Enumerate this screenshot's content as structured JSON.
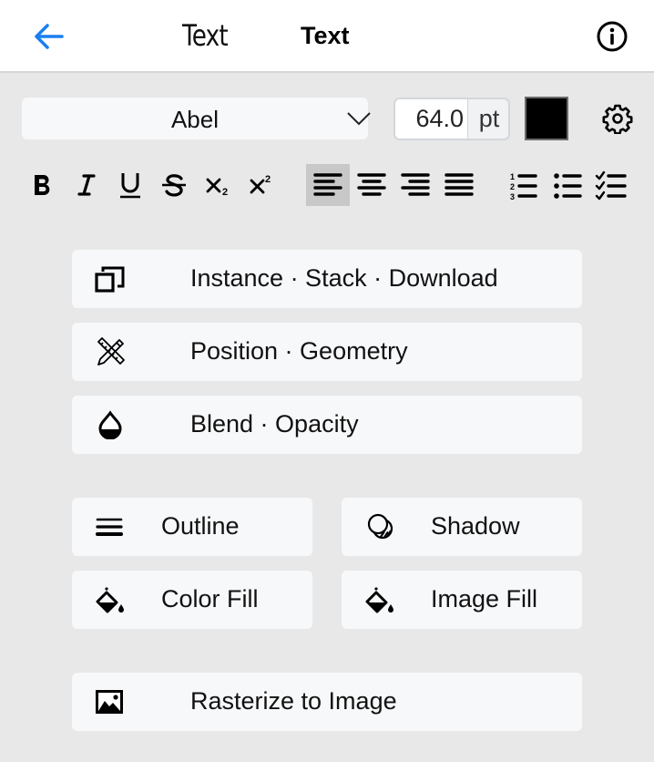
{
  "header": {
    "back_icon": "arrow-left-icon",
    "font_preview_title": "Text",
    "title": "Text",
    "info_icon": "info-circle-icon"
  },
  "font_controls": {
    "font_name": "Abel",
    "size_value": "64.0",
    "size_unit": "pt",
    "text_color": "#000000",
    "settings_icon": "gear-icon"
  },
  "format_toolbar": {
    "styles": [
      "bold",
      "italic",
      "underline",
      "strikethrough",
      "subscript",
      "superscript"
    ],
    "alignments": [
      "align-left",
      "align-center",
      "align-right",
      "align-justify"
    ],
    "active_alignment": "align-left",
    "lists": [
      "numbered-list",
      "bullet-list",
      "checklist"
    ]
  },
  "actions": {
    "instance": {
      "label": "Instance · Stack · Download",
      "icon": "duplicate-icon"
    },
    "position": {
      "label": "Position · Geometry",
      "icon": "pencil-ruler-icon"
    },
    "blend": {
      "label": "Blend · Opacity",
      "icon": "drop-icon"
    },
    "outline": {
      "label": "Outline",
      "icon": "lines-icon"
    },
    "shadow": {
      "label": "Shadow",
      "icon": "shadow-icon"
    },
    "color_fill": {
      "label": "Color Fill",
      "icon": "paint-bucket-icon"
    },
    "image_fill": {
      "label": "Image Fill",
      "icon": "paint-bucket-icon"
    },
    "rasterize": {
      "label": "Rasterize to Image",
      "icon": "image-icon"
    }
  },
  "colors": {
    "accent": "#1a7ef0",
    "panel_bg": "#e8e8e8",
    "button_bg": "#f7f8fa",
    "active_tool_bg": "#c8c8c8"
  }
}
